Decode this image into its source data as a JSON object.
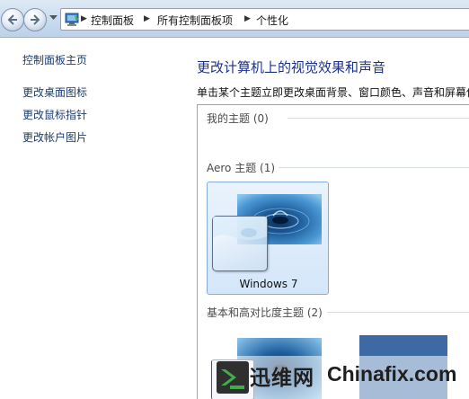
{
  "address_bar": {
    "back_icon": "left-arrow-icon",
    "forward_icon": "right-arrow-icon",
    "location_icon": "control-panel-icon",
    "breadcrumbs": [
      "控制面板",
      "所有控制面板项",
      "个性化"
    ]
  },
  "sidebar": {
    "home_link": "控制面板主页",
    "tasks": [
      "更改桌面图标",
      "更改鼠标指针",
      "更改帐户图片"
    ]
  },
  "main": {
    "title": "更改计算机上的视觉效果和声音",
    "description": "单击某个主题立即更改桌面背景、窗口颜色、声音和屏幕保护程序。"
  },
  "themes": {
    "my_themes": {
      "heading": "我的主题 (0)"
    },
    "aero_themes": {
      "heading": "Aero 主题 (1)",
      "items": [
        "Windows 7"
      ]
    },
    "basic_themes": {
      "heading": "基本和高对比度主题 (2)"
    }
  },
  "watermark": {
    "brand_cn": "迅维网",
    "brand_en": "Chinafix.com"
  },
  "colors": {
    "title_blue": "#1e3287",
    "link_blue": "#1c3d6e",
    "selection_border": "#84acdd"
  }
}
